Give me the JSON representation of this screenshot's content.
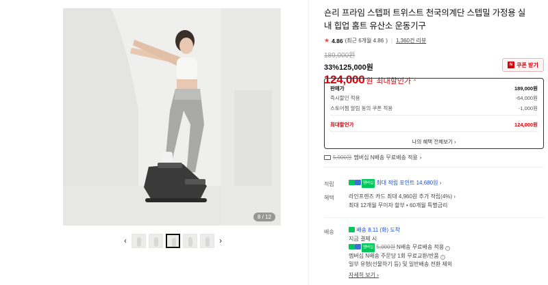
{
  "gallery": {
    "counter": "8 / 12",
    "thumbs": [
      "thumb-1",
      "thumb-2",
      "thumb-3",
      "thumb-4",
      "thumb-5"
    ],
    "active_thumb": 3
  },
  "product": {
    "title": "숀리 프라임 스텝퍼 트위스트 천국의계단 스텝밀 가정용 실내 힙업 홈트 유산소 운동기구",
    "rating": "4.86",
    "rating_recent": "(최근 6개월 4.86",
    "reviews": "1,360건 리뷰",
    "original_price": "189,000원",
    "discount_pct": "33%",
    "sale_price": "125,000원",
    "max_price": "124,000",
    "max_won": "원",
    "max_label": "최대할인가",
    "coupon_label": "쿠폰 받기"
  },
  "breakdown": {
    "rows": [
      {
        "label": "판매가",
        "value": "189,000원"
      },
      {
        "label": "즉시할인 적용",
        "value": "-64,000원"
      },
      {
        "label": "스토어찜 알림 동의 쿠폰 적용",
        "value": "-1,000원"
      },
      {
        "label": "최대할인가",
        "value": "124,000원"
      }
    ],
    "link": "나의 혜택 전체보기"
  },
  "member_shipping": {
    "old_fee": "5,000원",
    "text": "멤버십 N배송 무료배송 적용"
  },
  "points": {
    "label": "적립",
    "badge": "멤버십",
    "text": "최대 적립 포인트 14,680원"
  },
  "benefits": {
    "label": "혜택",
    "line1": "라인프렌즈 카드 최대 4,960원 추가 적립(4%)",
    "line2": "최대 12개월 무이자 할부 • 60개월 특별금리"
  },
  "delivery": {
    "label": "배송",
    "arrival_prefix": "배송",
    "arrival": "8.11 (화) 도착",
    "condition": "지금 결제 시",
    "fee_old": "5,000원",
    "fee_text": "N배송 무료배송 적용",
    "exchange": "멤버십 N배송 주문당 1회 무료교환/반품",
    "exclude": "일부 유형(선물하기 등) 및 일반배송 전환 제외",
    "more": "자세히 보기"
  },
  "colors": {
    "accent_red": "#d8000c",
    "npay_green": "#03c75a",
    "link_blue": "#1a4fce"
  }
}
